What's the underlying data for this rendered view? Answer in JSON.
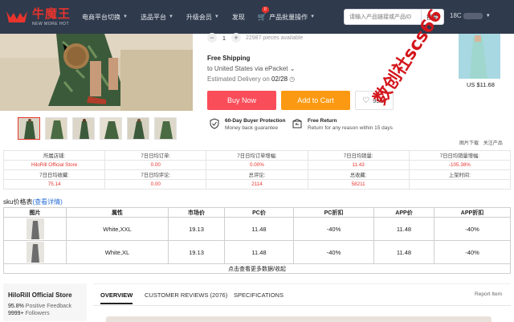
{
  "topbar": {
    "logo_text": "牛魔王",
    "logo_sub": "NEW MORE HOT",
    "nav": [
      {
        "label": "电商平台切换",
        "caret": true
      },
      {
        "label": "选品平台",
        "caret": true
      },
      {
        "label": "升级会员",
        "caret": true
      },
      {
        "label": "发现",
        "caret": false
      },
      {
        "label": "产品批量操作",
        "caret": true,
        "badge": "0"
      }
    ],
    "search_placeholder": "请输入产品链接或产品ID",
    "search_button": "搜索",
    "user_prefix": "18C"
  },
  "product": {
    "pieces_available": "22987 pieces available",
    "quantity": "1",
    "qty_minus": "−",
    "qty_plus": "+",
    "free_shipping": "Free Shipping",
    "ship_to": "to United States via ePacket ⌄",
    "estimated_label": "Estimated Delivery on ",
    "estimated_date": "02/28",
    "buy_now": "Buy Now",
    "add_to_cart": "Add to Cart",
    "wishlist_count": "9999",
    "guarantee_title": "60-Day Buyer Protection",
    "guarantee_desc": "Money back guarantee",
    "return_title": "Free Return",
    "return_desc": "Return for any reason within 15 days",
    "side_price": "US $11.68"
  },
  "watermark": "数创社scs66",
  "image_links": [
    "图片下载",
    "关注产品"
  ],
  "stats": {
    "rows": [
      [
        "所属店铺:",
        "7日日均订单:",
        "7日日均订单增幅:",
        "7日日均销量:",
        "7日日均销量增幅:"
      ],
      [
        "HiloRill Official Store",
        "0.00",
        "0.00%",
        "11.43",
        "-105.38%"
      ],
      [
        "7日日均收藏:",
        "7日日均评论:",
        "总评论:",
        "总收藏:",
        "上架时间:"
      ],
      [
        "75.14",
        "0.00",
        "2114",
        "58211",
        ""
      ]
    ]
  },
  "sku": {
    "title": "sku价格表",
    "detail_link": "(查看详情)",
    "headers": [
      "图片",
      "属性",
      "市场价",
      "PC价",
      "PC折扣",
      "APP价",
      "APP折扣"
    ],
    "rows": [
      [
        "",
        "White,XXL",
        "19.13",
        "11.48",
        "-40%",
        "11.48",
        "-40%"
      ],
      [
        "",
        "White,XL",
        "19.13",
        "11.48",
        "-40%",
        "11.48",
        "-40%"
      ]
    ],
    "more": "点击查看更多数据/收起"
  },
  "store": {
    "name": "HiloRill Official Store",
    "feedback_value": "95.8%",
    "feedback_label": " Positive Feedback",
    "followers_value": "9999+",
    "followers_label": " Followers"
  },
  "tabs": {
    "items": [
      "OVERVIEW",
      "CUSTOMER REVIEWS (2076)",
      "SPECIFICATIONS"
    ],
    "report": "Report Item"
  },
  "colors": {
    "topbar": "#2f3a4c",
    "buy": "#fa4d5a",
    "cart": "#fb9a12",
    "accent_red": "#e8342d",
    "link_blue": "#2a6fd6"
  }
}
